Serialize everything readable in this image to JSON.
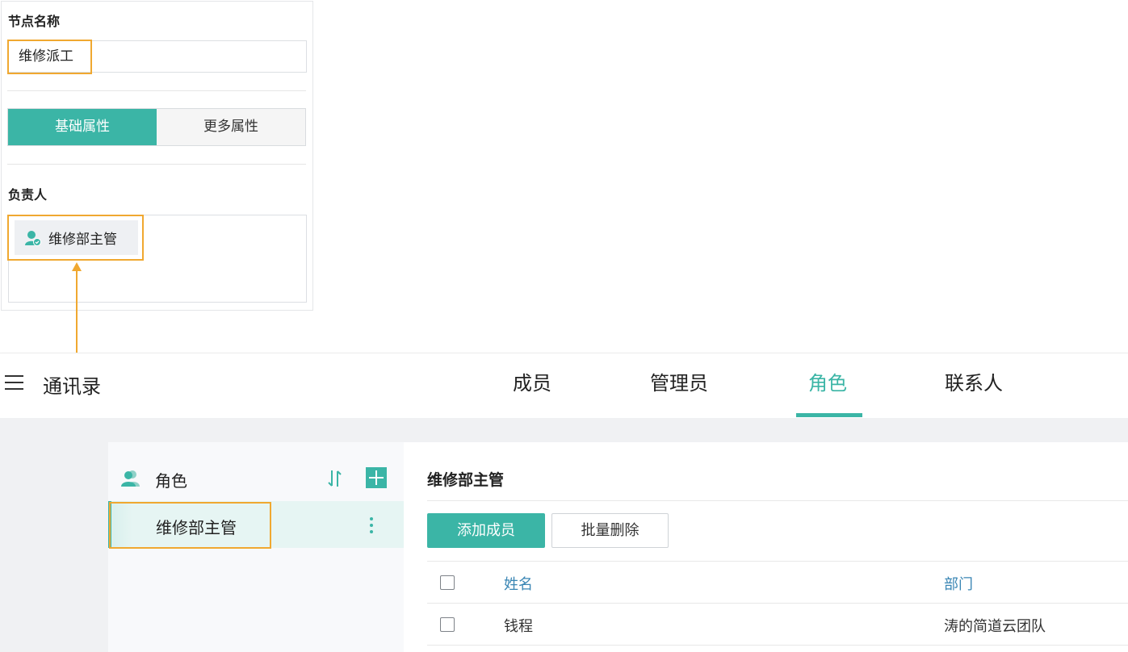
{
  "node_panel": {
    "name_label": "节点名称",
    "name_value": "维修派工",
    "tabs": [
      "基础属性",
      "更多属性"
    ],
    "owner_label": "负责人",
    "owner_chip": "维修部主管"
  },
  "app": {
    "title": "通讯录",
    "tabs": [
      "成员",
      "管理员",
      "角色",
      "联系人"
    ],
    "active_tab": "角色"
  },
  "roles_sidebar": {
    "header": "角色",
    "items": [
      "维修部主管"
    ]
  },
  "role_detail": {
    "title": "维修部主管",
    "add_button": "添加成员",
    "batch_delete_button": "批量删除",
    "columns": [
      "姓名",
      "部门"
    ],
    "rows": [
      {
        "name": "钱程",
        "department": "涛的简道云团队"
      }
    ]
  },
  "colors": {
    "accent": "#3bb5a6",
    "highlight": "#f0a830",
    "header_text": "#3a86b4"
  }
}
